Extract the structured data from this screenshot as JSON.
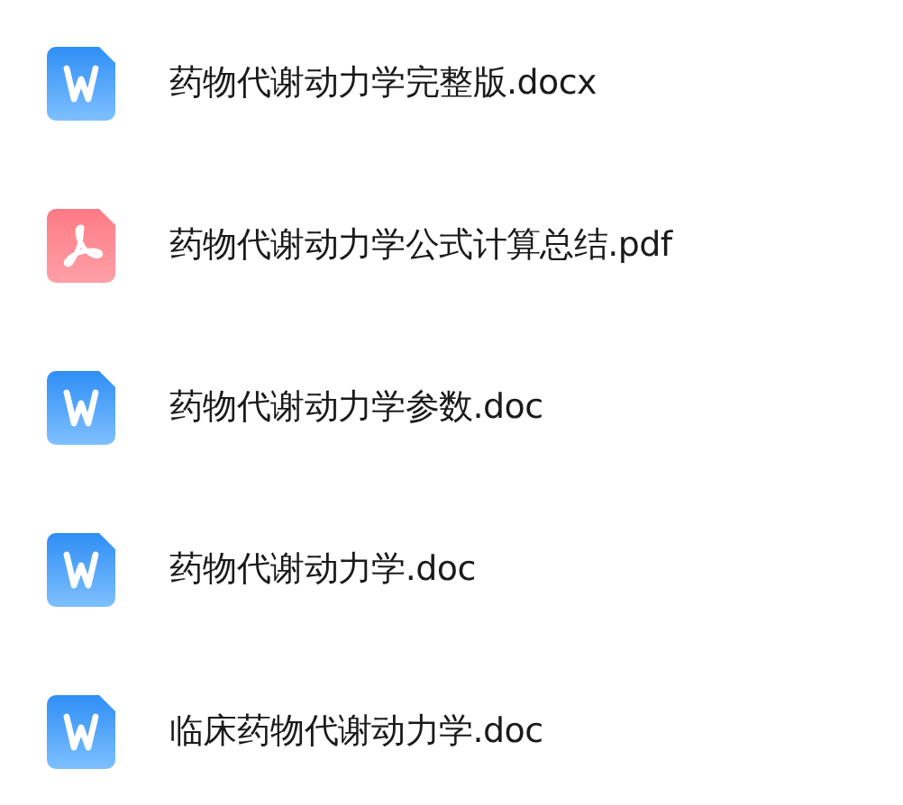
{
  "files": [
    {
      "kind": "word",
      "name": "药物代谢动力学完整版.docx"
    },
    {
      "kind": "pdf",
      "name": "药物代谢动力学公式计算总结.pdf"
    },
    {
      "kind": "word",
      "name": "药物代谢动力学参数.doc"
    },
    {
      "kind": "word",
      "name": "药物代谢动力学.doc"
    },
    {
      "kind": "word",
      "name": "临床药物代谢动力学.doc"
    }
  ]
}
